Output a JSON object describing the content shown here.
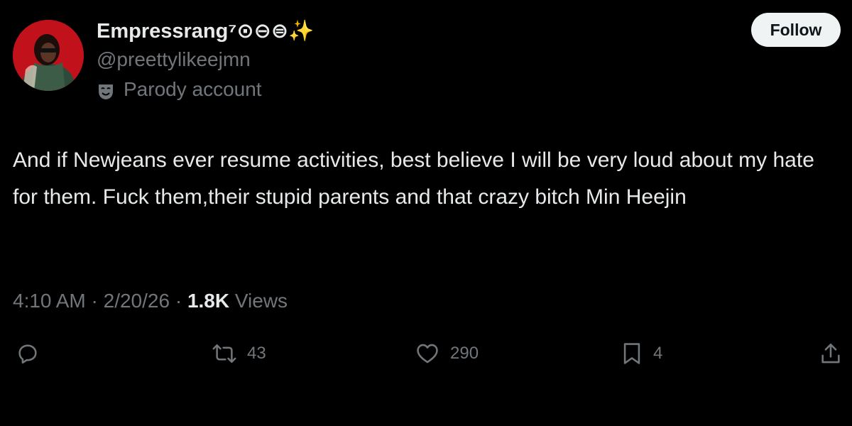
{
  "author": {
    "display_name": "Empressrang⁷⊙⊖⊜✨",
    "handle": "@preettylikeejmn",
    "parody_label": "Parody account",
    "avatar_icon": "profile-avatar"
  },
  "follow_button": {
    "label": "Follow"
  },
  "tweet": {
    "text": "And if Newjeans ever resume activities, best believe I will be very loud about my hate for them. Fuck them,their stupid parents and that crazy bitch Min Heejin"
  },
  "meta": {
    "time": "4:10 AM",
    "separator1": " · ",
    "date": "2/20/26",
    "separator2": " · ",
    "views_count": "1.8K",
    "views_label": " Views"
  },
  "actions": {
    "reply": {
      "icon": "reply-icon",
      "count": ""
    },
    "retweet": {
      "icon": "retweet-icon",
      "count": "43"
    },
    "like": {
      "icon": "heart-icon",
      "count": "290"
    },
    "bookmark": {
      "icon": "bookmark-icon",
      "count": "4"
    },
    "share": {
      "icon": "share-icon",
      "count": ""
    }
  },
  "colors": {
    "background": "#000000",
    "primary_text": "#e7e9ea",
    "secondary_text": "#71767b",
    "follow_bg": "#eff3f4",
    "follow_text": "#0f1419",
    "avatar_bg": "#c1121c"
  }
}
